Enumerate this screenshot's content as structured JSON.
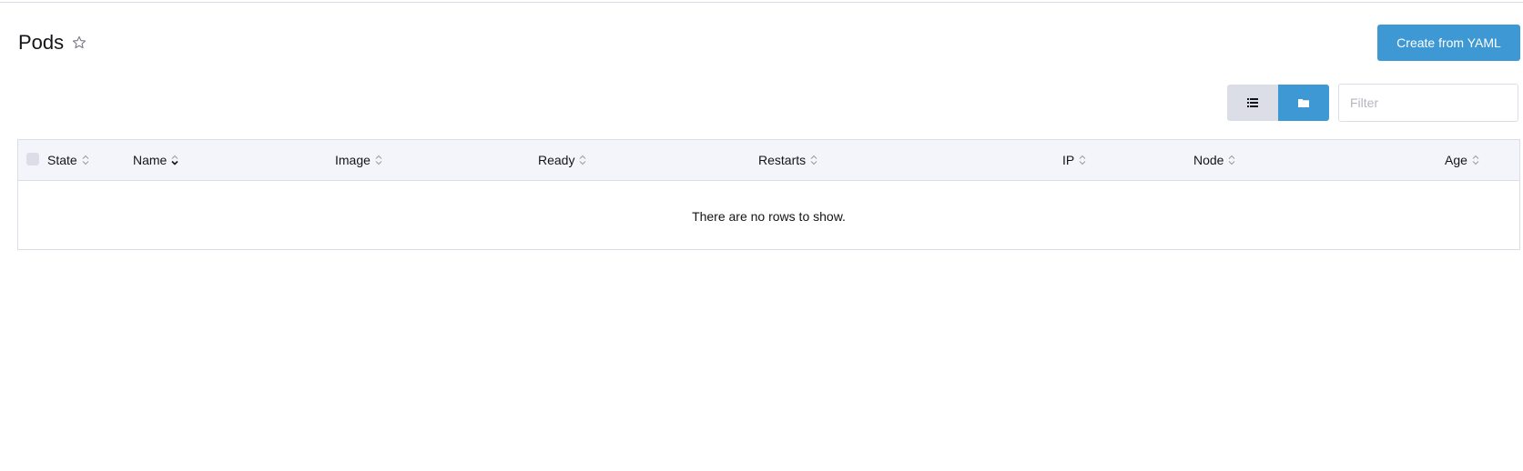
{
  "page": {
    "title": "Pods",
    "star_icon": "star-outline-icon"
  },
  "actions": {
    "create_label": "Create from YAML"
  },
  "view_toggle": {
    "list_icon": "list-icon",
    "group_icon": "folder-icon",
    "active": "group"
  },
  "filter": {
    "placeholder": "Filter",
    "value": ""
  },
  "table": {
    "columns": [
      {
        "label": "State",
        "sort": "none"
      },
      {
        "label": "Name",
        "sort": "desc"
      },
      {
        "label": "Image",
        "sort": "none"
      },
      {
        "label": "Ready",
        "sort": "none"
      },
      {
        "label": "Restarts",
        "sort": "none"
      },
      {
        "label": "IP",
        "sort": "none"
      },
      {
        "label": "Node",
        "sort": "none"
      },
      {
        "label": "Age",
        "sort": "none"
      }
    ],
    "rows": [],
    "empty_message": "There are no rows to show."
  },
  "colors": {
    "accent": "#3d98d3",
    "header_bg": "#f4f5fa",
    "border": "#dcdee7"
  }
}
